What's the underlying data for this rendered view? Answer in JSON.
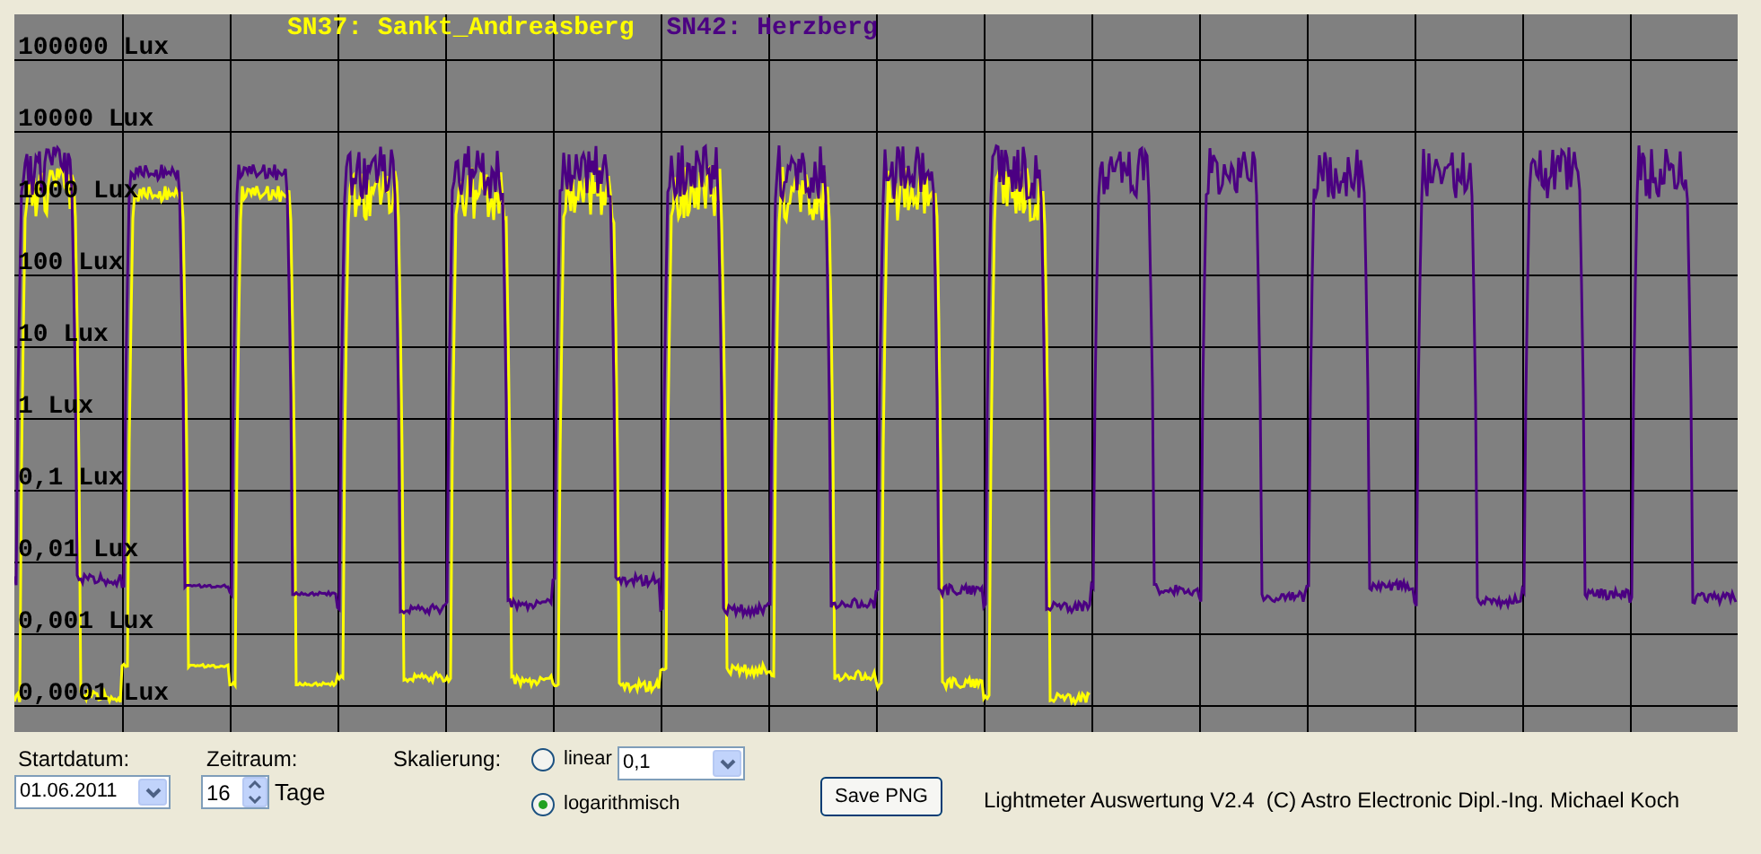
{
  "chart": {
    "legend": [
      {
        "label": "SN37: Sankt_Andreasberg",
        "color": "#ffff00"
      },
      {
        "label": "SN42: Herzberg",
        "color": "#4b0082"
      }
    ],
    "y_axis_labels": [
      "100000 Lux",
      "10000 Lux",
      "1000 Lux",
      "100 Lux",
      "10 Lux",
      "1 Lux",
      "0,1 Lux",
      "0,01 Lux",
      "0,001 Lux",
      "0,0001 Lux"
    ]
  },
  "controls": {
    "start_date": {
      "label": "Startdatum:",
      "value": "01.06.2011"
    },
    "period": {
      "label": "Zeitraum:",
      "value": "16",
      "unit": "Tage"
    },
    "scaling": {
      "label": "Skalierung:",
      "options": [
        {
          "label": "linear",
          "selected": false
        },
        {
          "label": "logarithmisch",
          "selected": true
        }
      ],
      "linear_value": "0,1"
    },
    "save_button": "Save PNG"
  },
  "footer": "Lightmeter Auswertung V2.4  (C) Astro Electronic Dipl.-Ing. Michael Koch"
}
